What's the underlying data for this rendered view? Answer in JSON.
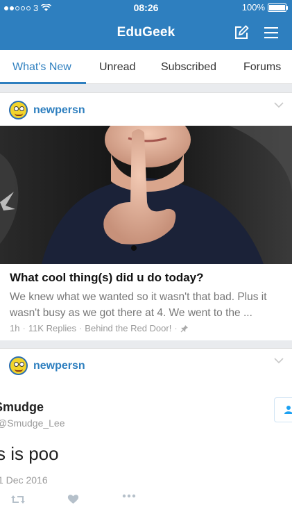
{
  "status_bar": {
    "carrier": "3",
    "time": "08:26",
    "battery": "100%"
  },
  "header": {
    "title": "EduGeek",
    "compose_icon": "compose-icon",
    "menu_icon": "hamburger-menu-icon"
  },
  "tabs": [
    {
      "label": "What's New",
      "active": true
    },
    {
      "label": "Unread",
      "active": false
    },
    {
      "label": "Subscribed",
      "active": false
    },
    {
      "label": "Forums",
      "active": false
    }
  ],
  "posts": [
    {
      "author": "newpersn",
      "title": "What cool thing(s) did u do today?",
      "excerpt": "We knew what we wanted so it wasn't that bad. Plus it wasn't busy as we got there at 4. We went to the ...",
      "age": "1h",
      "replies": "11K Replies",
      "forum": "Behind the Red Door!"
    },
    {
      "author": "newpersn",
      "tweet": {
        "name": "Smudge",
        "handle": "@Smudge_Lee",
        "text": "s is poo",
        "date": "1 Dec 2016"
      }
    }
  ],
  "colors": {
    "brand": "#2e7fbf",
    "background": "#e9ebee"
  }
}
